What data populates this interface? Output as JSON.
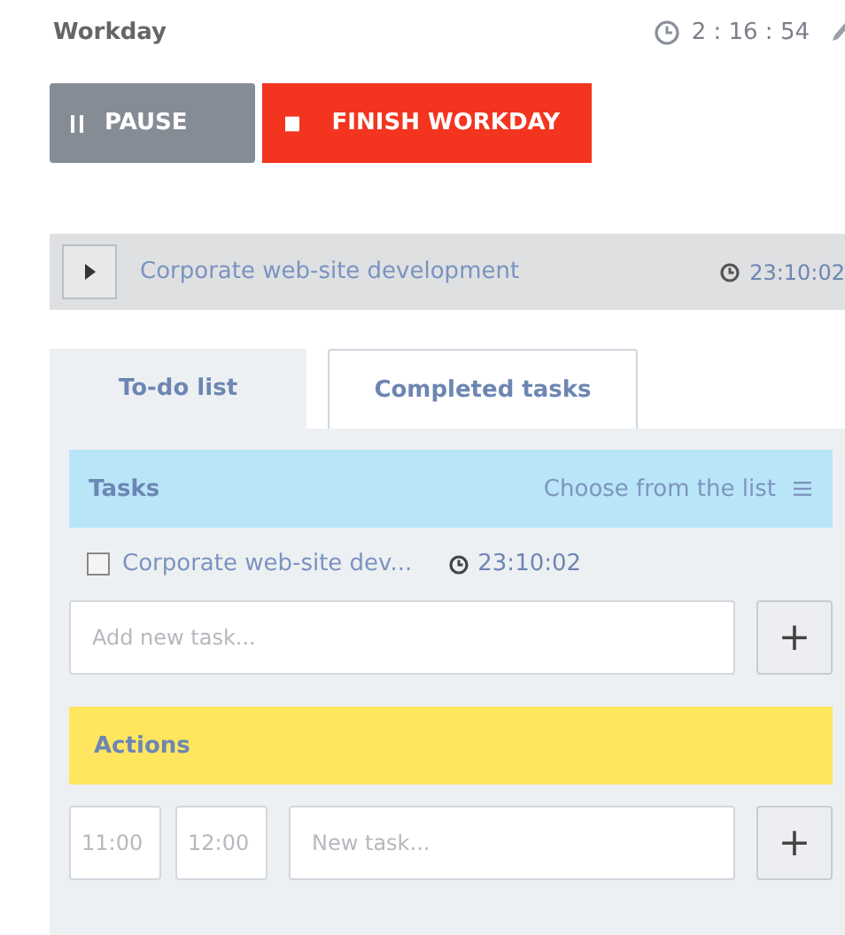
{
  "header": {
    "title": "Workday",
    "timer": "2 : 16 : 54"
  },
  "buttons": [
    {
      "kind": "pause",
      "label": "PAUSE"
    },
    {
      "kind": "finish",
      "label": "FINISH WORKDAY"
    }
  ],
  "current_task": {
    "name": "Corporate web-site development",
    "time": "23:10:02"
  },
  "tabs": [
    {
      "label": "To-do list",
      "selected": true
    },
    {
      "label": "Completed tasks",
      "selected": false
    }
  ],
  "tasks": {
    "title": "Tasks",
    "choose_link": "Choose from the list",
    "items": [
      {
        "name": "Corporate web-site dev...",
        "time": "23:10:02",
        "checked": false
      }
    ],
    "input": {
      "placeholder": "Add new task..."
    },
    "add_button": "+"
  },
  "actions": {
    "title": "Actions",
    "start": {
      "placeholder": "11:00"
    },
    "end": {
      "placeholder": "12:00"
    },
    "input": {
      "placeholder": "New task..."
    },
    "add_button": "+"
  }
}
